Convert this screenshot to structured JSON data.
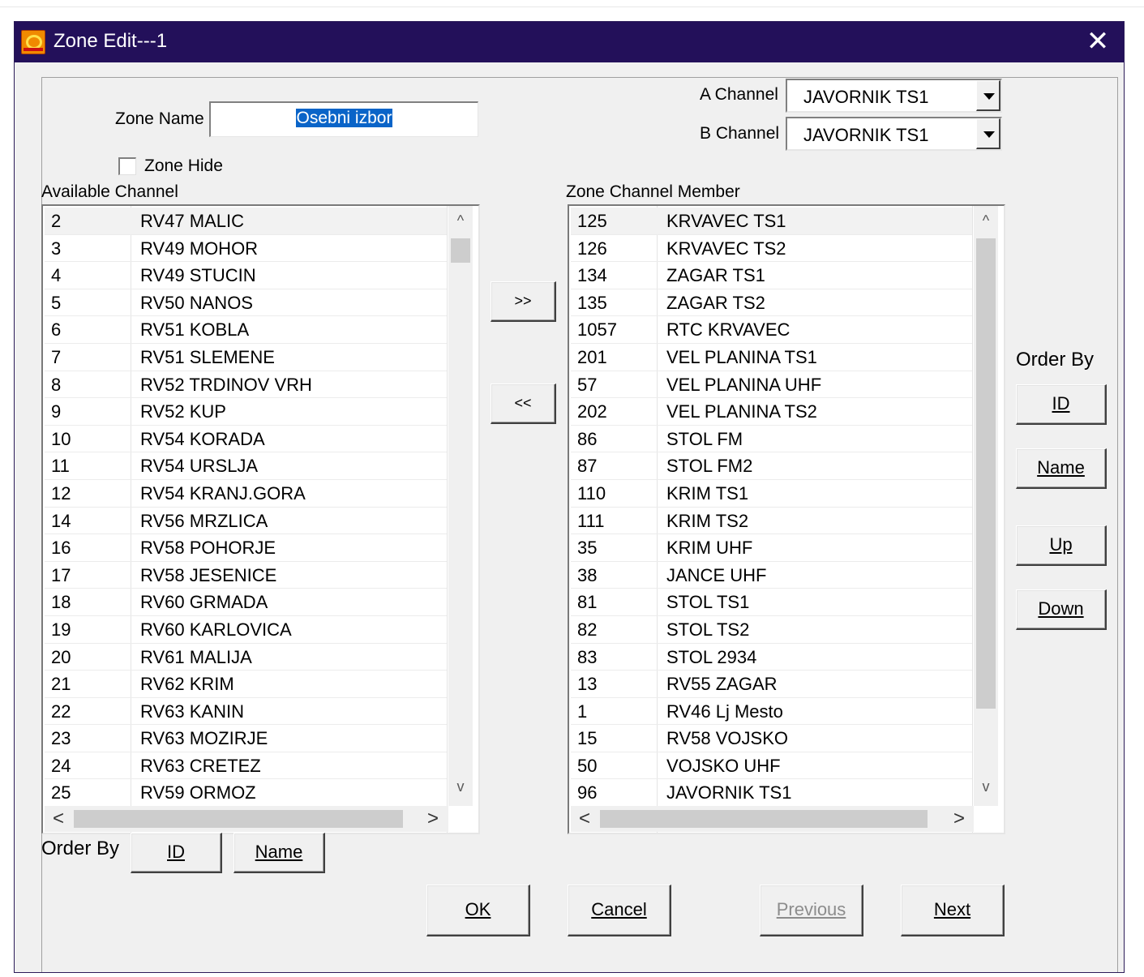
{
  "window": {
    "title": "Zone Edit---1",
    "close_glyph": "✕",
    "icon": "app-logo-icon"
  },
  "zone_name": {
    "label": "Zone Name",
    "value": "Osebni izbor"
  },
  "zone_hide": {
    "label": "Zone Hide",
    "checked": false
  },
  "a_channel": {
    "label": "A Channel",
    "value": "JAVORNIK TS1"
  },
  "b_channel": {
    "label": "B Channel",
    "value": "JAVORNIK TS1"
  },
  "available": {
    "label": "Available Channel",
    "rows": [
      {
        "id": "2",
        "name": "RV47 MALIC"
      },
      {
        "id": "3",
        "name": "RV49 MOHOR"
      },
      {
        "id": "4",
        "name": "RV49 STUCIN"
      },
      {
        "id": "5",
        "name": "RV50 NANOS"
      },
      {
        "id": "6",
        "name": "RV51 KOBLA"
      },
      {
        "id": "7",
        "name": "RV51 SLEMENE"
      },
      {
        "id": "8",
        "name": "RV52 TRDINOV VRH"
      },
      {
        "id": "9",
        "name": "RV52 KUP"
      },
      {
        "id": "10",
        "name": "RV54 KORADA"
      },
      {
        "id": "11",
        "name": "RV54 URSLJA"
      },
      {
        "id": "12",
        "name": "RV54 KRANJ.GORA"
      },
      {
        "id": "14",
        "name": "RV56 MRZLICA"
      },
      {
        "id": "16",
        "name": "RV58 POHORJE"
      },
      {
        "id": "17",
        "name": "RV58 JESENICE"
      },
      {
        "id": "18",
        "name": "RV60 GRMADA"
      },
      {
        "id": "19",
        "name": "RV60 KARLOVICA"
      },
      {
        "id": "20",
        "name": "RV61 MALIJA"
      },
      {
        "id": "21",
        "name": "RV62 KRIM"
      },
      {
        "id": "22",
        "name": "RV63 KANIN"
      },
      {
        "id": "23",
        "name": "RV63 MOZIRJE"
      },
      {
        "id": "24",
        "name": "RV63 CRETEZ"
      },
      {
        "id": "25",
        "name": "RV59 ORMOZ"
      }
    ]
  },
  "members": {
    "label": "Zone Channel Member",
    "rows": [
      {
        "id": "125",
        "name": "KRVAVEC TS1"
      },
      {
        "id": "126",
        "name": "KRVAVEC TS2"
      },
      {
        "id": "134",
        "name": "ZAGAR TS1"
      },
      {
        "id": "135",
        "name": "ZAGAR TS2"
      },
      {
        "id": "1057",
        "name": "RTC KRVAVEC"
      },
      {
        "id": "201",
        "name": "VEL PLANINA TS1"
      },
      {
        "id": "57",
        "name": "VEL PLANINA UHF"
      },
      {
        "id": "202",
        "name": "VEL PLANINA TS2"
      },
      {
        "id": "86",
        "name": "STOL FM"
      },
      {
        "id": "87",
        "name": "STOL FM2"
      },
      {
        "id": "110",
        "name": "KRIM TS1"
      },
      {
        "id": "111",
        "name": "KRIM TS2"
      },
      {
        "id": "35",
        "name": "KRIM UHF"
      },
      {
        "id": "38",
        "name": "JANCE UHF"
      },
      {
        "id": "81",
        "name": "STOL TS1"
      },
      {
        "id": "82",
        "name": "STOL TS2"
      },
      {
        "id": "83",
        "name": "STOL 2934"
      },
      {
        "id": "13",
        "name": "RV55 ZAGAR"
      },
      {
        "id": "1",
        "name": "RV46 Lj Mesto"
      },
      {
        "id": "15",
        "name": "RV58 VOJSKO"
      },
      {
        "id": "50",
        "name": "VOJSKO UHF"
      },
      {
        "id": "96",
        "name": "JAVORNIK TS1"
      }
    ]
  },
  "transfer": {
    "add_label": ">>",
    "remove_label": "<<"
  },
  "order_by_right": {
    "label": "Order By",
    "id_label": "ID",
    "name_label": "Name",
    "up_label": "Up",
    "down_label": "Down"
  },
  "order_by_left": {
    "label": "Order By",
    "id_label": "ID",
    "name_label": "Name"
  },
  "footer": {
    "ok_label": "OK",
    "cancel_label": "Cancel",
    "previous_label": "Previous",
    "next_label": "Next"
  },
  "scroll_glyphs": {
    "up": "^",
    "down": "v",
    "left": "<",
    "right": ">"
  }
}
